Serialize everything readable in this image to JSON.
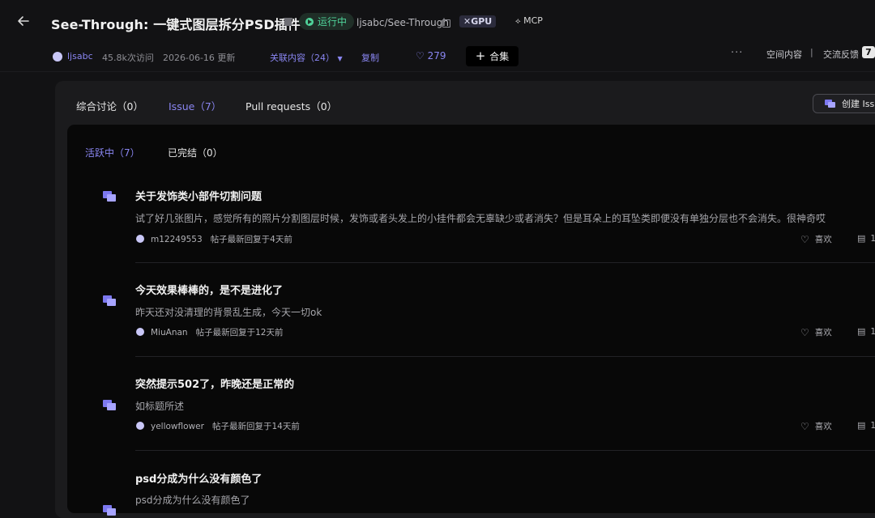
{
  "header": {
    "title": "See-Through: 一键式图层拆分PSD插件",
    "status": "运行中",
    "repo": "ljsabc/See-Through",
    "gpu_badge": "GPU",
    "mcp_badge": "MCP"
  },
  "meta": {
    "author": "ljsabc",
    "visits": "45.8k次访问",
    "updated": "2026-06-16 更新",
    "related": "关联内容（24）",
    "copy": "复制",
    "likes": "279",
    "collection": "合集",
    "space_content": "空间内容",
    "feedback": "交流反馈",
    "feedback_count": "7"
  },
  "tabs": [
    {
      "label": "综合讨论（0）"
    },
    {
      "label": "Issue（7）"
    },
    {
      "label": "Pull requests（0）"
    }
  ],
  "create_button": "创建 Issu",
  "subtabs": [
    {
      "label": "活跃中（7）"
    },
    {
      "label": "已完结（0）"
    }
  ],
  "issues": [
    {
      "title": "关于发饰类小部件切割问题",
      "body": "试了好几张图片，感觉所有的照片分割图层时候，发饰或者头发上的小挂件都会无辜缺少或者消失？但是耳朵上的耳坠类即便没有单独分层也不会消失。很神奇哎",
      "user": "m12249553",
      "time": "帖子最新回复于4天前",
      "like": "喜欢",
      "comments": "1"
    },
    {
      "title": "今天效果棒棒的，是不是进化了",
      "body": "昨天还对没清理的背景乱生成，今天一切ok",
      "user": "MiuAnan",
      "time": "帖子最新回复于12天前",
      "like": "喜欢",
      "comments": "1"
    },
    {
      "title": "突然提示502了，昨晚还是正常的",
      "body": "如标题所述",
      "user": "yellowflower",
      "time": "帖子最新回复于14天前",
      "like": "喜欢",
      "comments": "1"
    },
    {
      "title": "psd分成为什么没有颜色了",
      "body": "psd分成为什么没有颜色了"
    }
  ]
}
